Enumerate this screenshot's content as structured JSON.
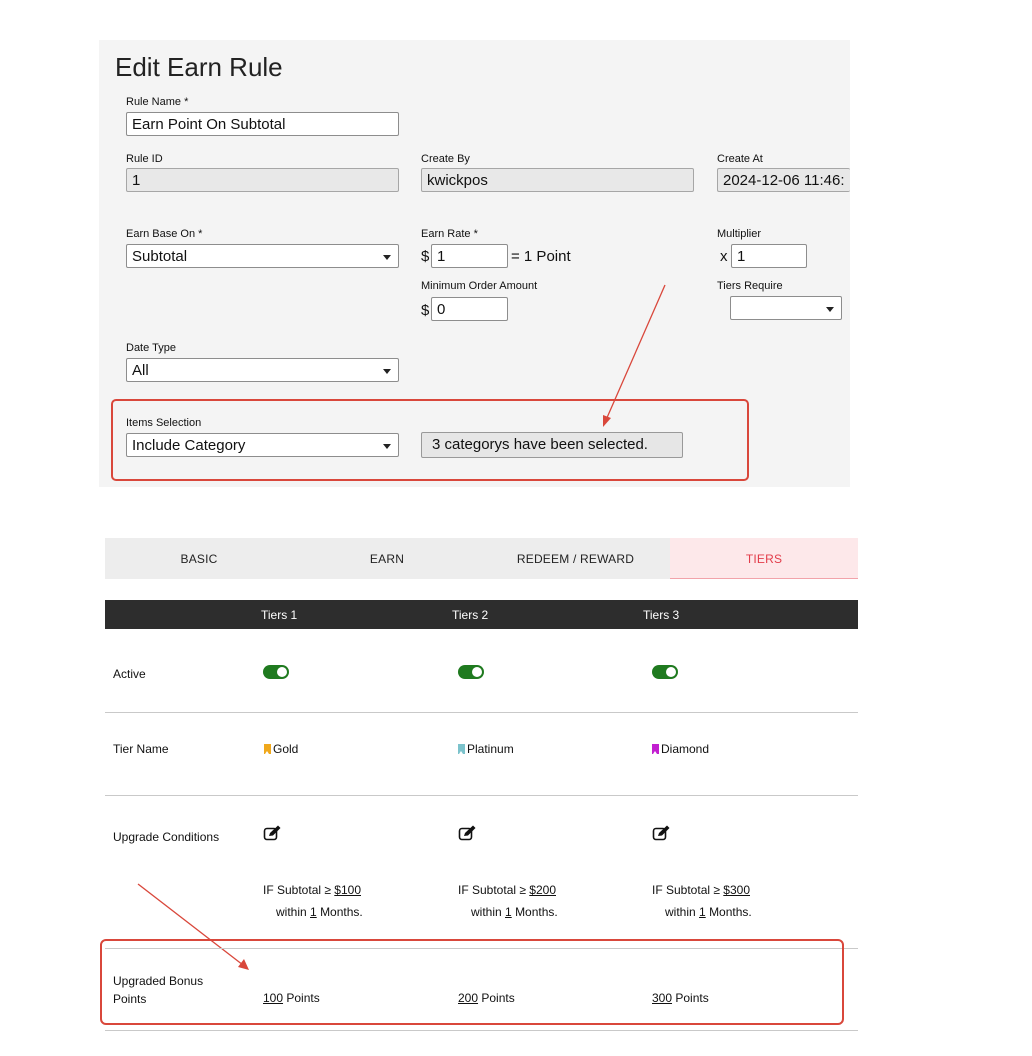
{
  "rule_form": {
    "title": "Edit Earn Rule",
    "rule_name": {
      "label": "Rule Name *",
      "value": "Earn Point On Subtotal"
    },
    "rule_id": {
      "label": "Rule ID",
      "value": "1"
    },
    "create_by": {
      "label": "Create By",
      "value": "kwickpos"
    },
    "create_at": {
      "label": "Create At",
      "value": "2024-12-06 11:46:"
    },
    "earn_base_on": {
      "label": "Earn Base On *",
      "value": "Subtotal"
    },
    "earn_rate": {
      "label": "Earn Rate *",
      "prefix": "$",
      "value": "1",
      "suffix": "= 1 Point"
    },
    "multiplier": {
      "label": "Multiplier",
      "prefix": "x",
      "value": "1"
    },
    "minimum_order": {
      "label": "Minimum Order Amount",
      "prefix": "$",
      "value": "0"
    },
    "tiers_require": {
      "label": "Tiers Require",
      "value": ""
    },
    "date_type": {
      "label": "Date Type",
      "value": "All"
    },
    "items_selection": {
      "label": "Items Selection",
      "value": "Include Category",
      "summary": "3 categorys have been selected."
    }
  },
  "tabs": [
    "BASIC",
    "EARN",
    "REDEEM / REWARD",
    "TIERS"
  ],
  "active_tab": "TIERS",
  "tiers_table": {
    "headers": [
      "Tiers 1",
      "Tiers 2",
      "Tiers 3"
    ],
    "row_labels": {
      "active": "Active",
      "tier_name": "Tier Name",
      "upgrade_conditions": "Upgrade Conditions",
      "bonus_line1": "Upgraded Bonus",
      "bonus_line2": "Points"
    },
    "tiers": [
      {
        "name": "Gold",
        "flag_color": "#f0a81c",
        "active": true,
        "cond_prefix": "IF Subtotal ≥",
        "amount": "$100",
        "within": "within",
        "months": "1",
        "months_unit": "Months.",
        "bonus": "100",
        "bonus_unit": "Points"
      },
      {
        "name": "Platinum",
        "flag_color": "#7cc3cc",
        "active": true,
        "cond_prefix": "IF Subtotal ≥",
        "amount": "$200",
        "within": "within",
        "months": "1",
        "months_unit": "Months.",
        "bonus": "200",
        "bonus_unit": "Points"
      },
      {
        "name": "Diamond",
        "flag_color": "#c21fd0",
        "active": true,
        "cond_prefix": "IF Subtotal ≥",
        "amount": "$300",
        "within": "within",
        "months": "1",
        "months_unit": "Months.",
        "bonus": "300",
        "bonus_unit": "Points"
      }
    ]
  },
  "colors": {
    "highlight": "#d9473b",
    "toggle_on": "#1f7a1f",
    "active_tab_text": "#e23c4a"
  }
}
